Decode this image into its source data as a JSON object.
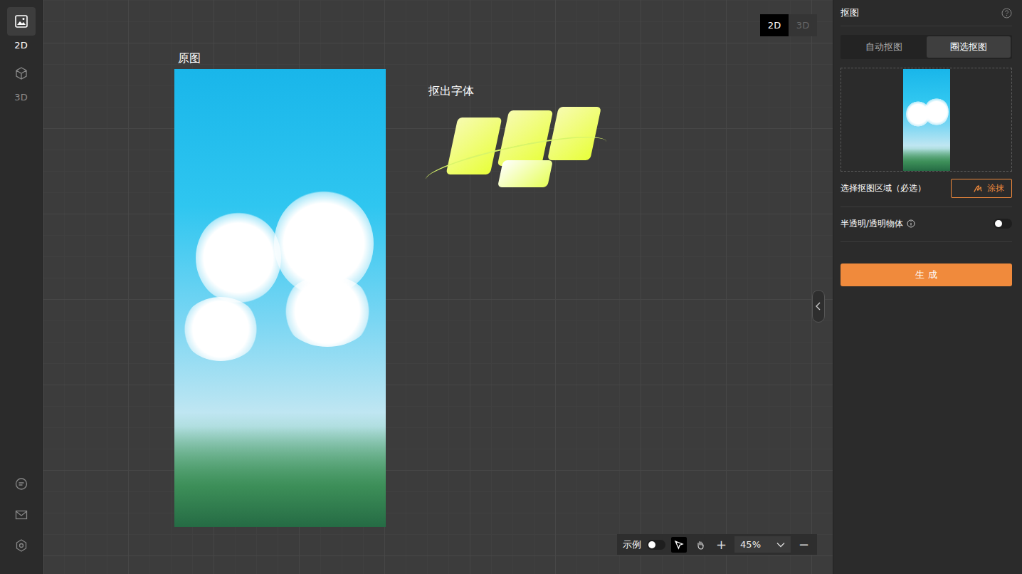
{
  "sidebar": {
    "items": [
      {
        "label": "2D",
        "kind": "image",
        "selected": true
      },
      {
        "label": "3D",
        "kind": "cube",
        "selected": false
      }
    ]
  },
  "canvas": {
    "original_label": "原图",
    "result_label": "抠出字体",
    "mode_switch": [
      {
        "label": "2D",
        "selected": true
      },
      {
        "label": "3D",
        "selected": false
      }
    ],
    "toolbar": {
      "example_label": "示例",
      "example_on": false,
      "tools": [
        {
          "kind": "select",
          "selected": true
        },
        {
          "kind": "hand",
          "selected": false
        }
      ],
      "zoom_in": "+",
      "zoom": "45%",
      "zoom_out": "−"
    }
  },
  "panel": {
    "title": "抠图",
    "tabs": [
      {
        "label": "自动抠图",
        "selected": false
      },
      {
        "label": "圈选抠图",
        "selected": true
      }
    ],
    "region_label": "选择抠图区域（必选）",
    "brush_button": "涂抹",
    "transparent_label": "半透明/透明物体",
    "transparent_on": false,
    "generate_button": "生 成"
  }
}
